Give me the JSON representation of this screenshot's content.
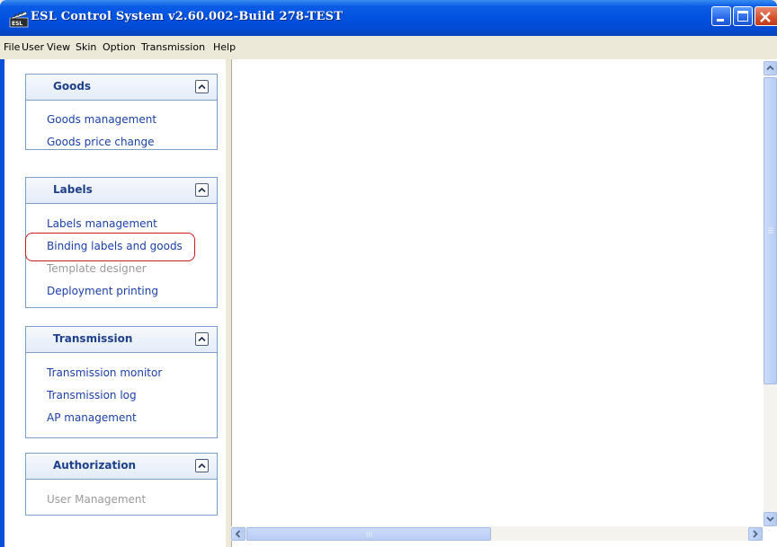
{
  "window": {
    "title": "ESL Control System v2.60.002-Build 278-TEST",
    "app_icon": "esl-app-icon",
    "controls": [
      "minimize-icon",
      "maximize-icon",
      "close-icon"
    ]
  },
  "menubar": {
    "items": [
      "File",
      "User",
      "View",
      "Skin",
      "Option",
      "Transmission",
      "Help"
    ]
  },
  "sidebar": {
    "panels": [
      {
        "title": "Goods",
        "collapse_icon": "chevron-up-icon",
        "links": [
          {
            "label": "Goods management",
            "enabled": true
          },
          {
            "label": "Goods price change",
            "enabled": true
          }
        ]
      },
      {
        "title": "Labels",
        "collapse_icon": "chevron-up-icon",
        "links": [
          {
            "label": "Labels management",
            "enabled": true
          },
          {
            "label": "Binding labels and goods",
            "enabled": true,
            "highlighted": true
          },
          {
            "label": "Template designer",
            "enabled": false
          },
          {
            "label": "Deployment printing",
            "enabled": true
          }
        ]
      },
      {
        "title": "Transmission",
        "collapse_icon": "chevron-up-icon",
        "links": [
          {
            "label": "Transmission monitor",
            "enabled": true
          },
          {
            "label": "Transmission log",
            "enabled": true
          },
          {
            "label": "AP management",
            "enabled": true
          }
        ]
      },
      {
        "title": "Authorization",
        "collapse_icon": "chevron-up-icon",
        "links": [
          {
            "label": "User Management",
            "enabled": false
          }
        ]
      }
    ]
  },
  "colors": {
    "titlebar": "#0a5ce6",
    "link": "#1a3fa8",
    "link_disabled": "#9a9a9a",
    "panel_title": "#1e3f8a",
    "highlight_ring": "#d01c1c"
  }
}
